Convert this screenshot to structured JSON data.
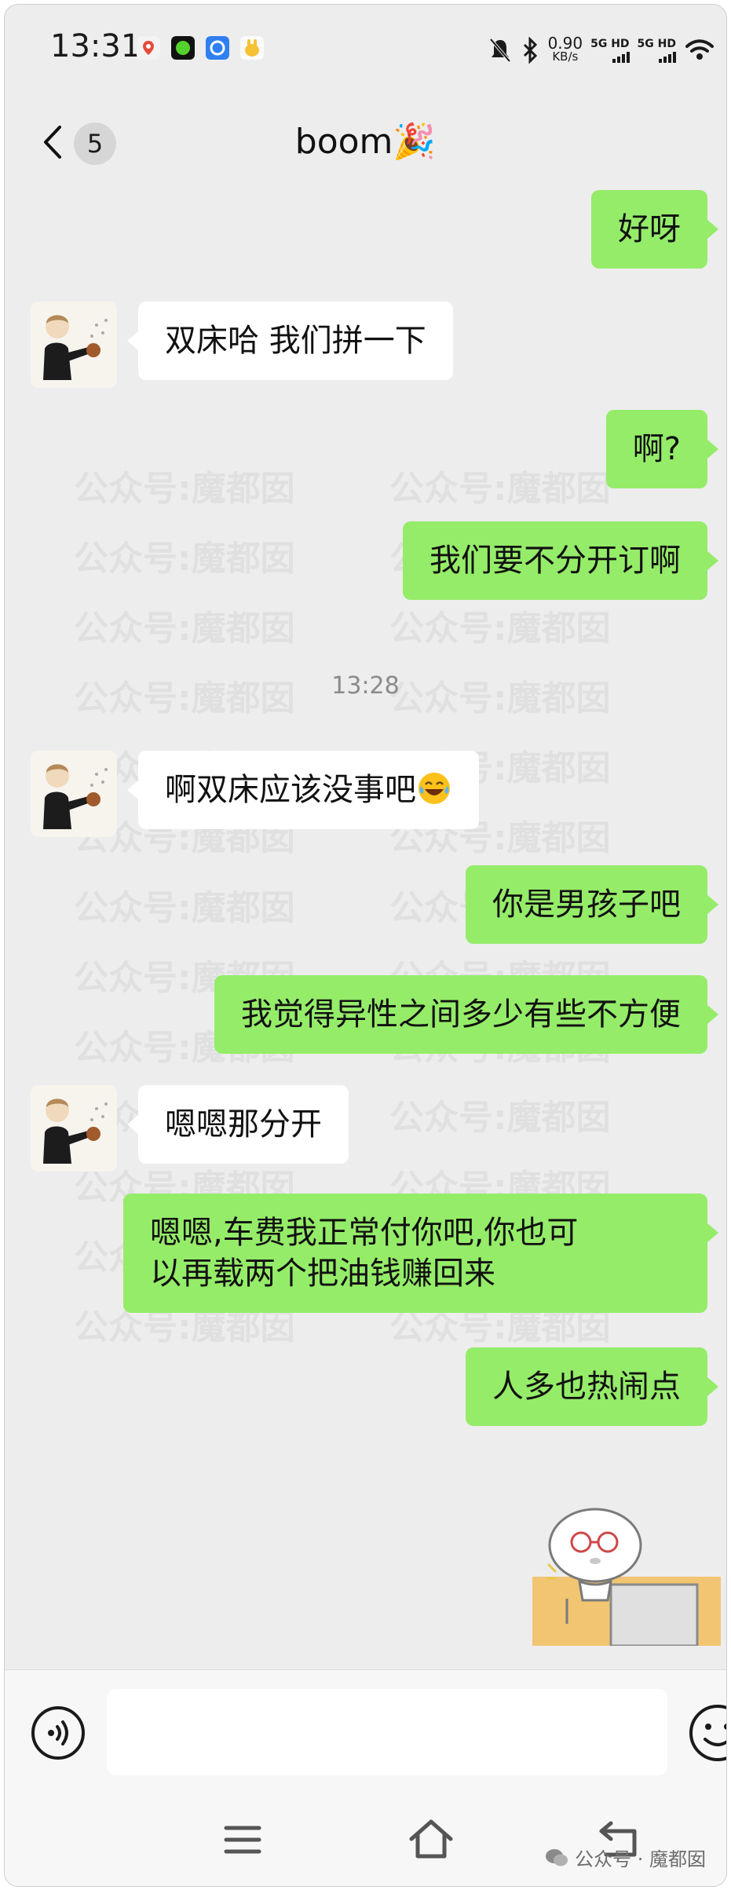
{
  "status_bar": {
    "time": "13:31",
    "net_speed_value": "0.90",
    "net_speed_unit": "KB/s",
    "network_1": "5G HD",
    "network_2": "5G HD",
    "app_icons": [
      "maps-icon",
      "green-app-icon",
      "blue-app-icon",
      "yellow-app-icon"
    ]
  },
  "header": {
    "unread_count": "5",
    "title": "boom🎉"
  },
  "messages": [
    {
      "side": "out",
      "text": "好呀"
    },
    {
      "side": "in",
      "text": "双床哈 我们拼一下"
    },
    {
      "side": "out",
      "text": "啊?"
    },
    {
      "side": "out",
      "text": "我们要不分开订啊"
    },
    {
      "side": "in",
      "text": "啊双床应该没事吧",
      "emoji": "laughing-tears-emoji"
    },
    {
      "side": "out",
      "text": "你是男孩子吧"
    },
    {
      "side": "out",
      "text": "我觉得异性之间多少有些不方便"
    },
    {
      "side": "in",
      "text": "嗯嗯那分开"
    },
    {
      "side": "out",
      "text": "嗯嗯,车费我正常付你吧,你也可\n以再载两个把油钱赚回来"
    },
    {
      "side": "out",
      "text": "人多也热闹点"
    }
  ],
  "time_separator": "13:28",
  "watermark": {
    "text_left": "公众号:魔都囡",
    "text_right": "公众号:魔都囡"
  },
  "input": {
    "value": "",
    "placeholder": ""
  },
  "footer": {
    "source_label": "公众号 · 魔都囡"
  },
  "colors": {
    "background": "#ededed",
    "outgoing_bubble": "#95ec69",
    "incoming_bubble": "#ffffff"
  }
}
